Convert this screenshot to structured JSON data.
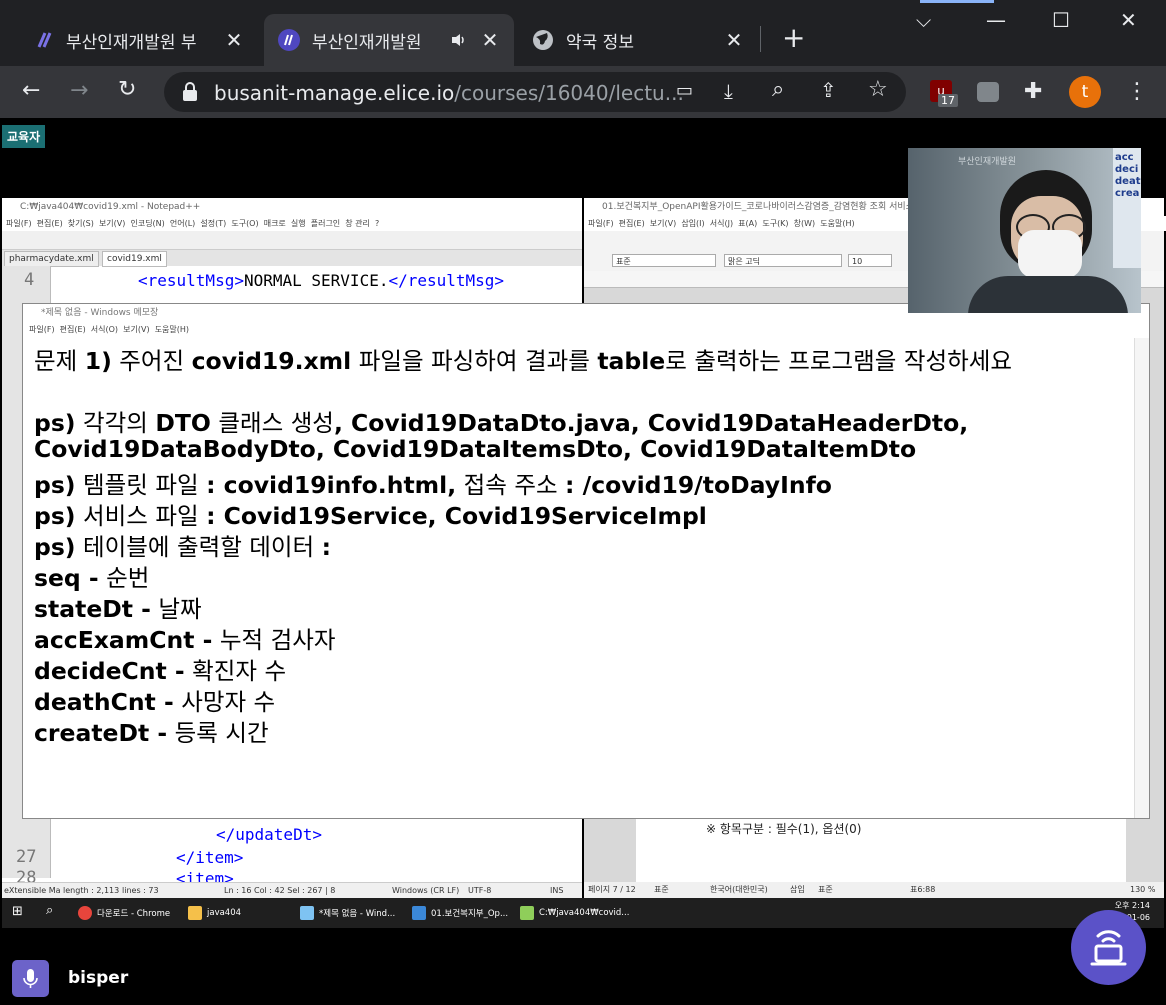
{
  "browser": {
    "tabs": [
      {
        "title": "부산인재개발원 부",
        "favicon": "elice-logo-icon",
        "active": false
      },
      {
        "title": "부산인재개발원",
        "favicon": "elice-logo-icon",
        "active": true,
        "audio": "speaker-icon"
      },
      {
        "title": "약국 정보",
        "favicon": "globe-icon",
        "active": false
      }
    ],
    "url_host": "busanit-manage.elice.io",
    "url_path": "/courses/16040/lectu...",
    "extension_badge": "17",
    "profile_initial": "t",
    "accent": "#4f47c0",
    "profile_color": "#e8710a"
  },
  "share": {
    "role_badge": "교육자",
    "presenter_name": "bisper"
  },
  "notepadpp": {
    "title": "C:₩java404₩covid19.xml - Notepad++",
    "menu": [
      "파일(F)",
      "편집(E)",
      "찾기(S)",
      "보기(V)",
      "인코딩(N)",
      "언어(L)",
      "설정(T)",
      "도구(O)",
      "매크로",
      "실행",
      "플러그인",
      "창 관리",
      "?"
    ],
    "tabs": [
      "pharmacydate.xml",
      "covid19.xml"
    ],
    "lines": [
      {
        "num": "4",
        "open": "<resultMsg>",
        "text": "NORMAL SERVICE.",
        "close": "</resultMsg>"
      },
      {
        "num": "",
        "open": "</updateDt>",
        "text": "",
        "close": ""
      },
      {
        "num": "27",
        "open": "</item>",
        "text": "",
        "close": ""
      },
      {
        "num": "28",
        "open": "<item>",
        "text": "",
        "close": ""
      }
    ],
    "status": {
      "type": "eXtensible Ma length : 2,113",
      "lines": "lines : 73",
      "pos": "Ln : 16    Col : 42    Sel : 267 | 8",
      "eol": "Windows (CR LF)",
      "enc": "UTF-8",
      "mode": "INS"
    }
  },
  "hwp": {
    "title": "01.보건복지부_OpenAPI활용가이드_코로나바이러스감염증_감염현황 조회 서비스_",
    "menu": [
      "파일(F)",
      "편집(E)",
      "보기(V)",
      "삽입(I)",
      "서식(J)",
      "표(A)",
      "도구(K)",
      "창(W)",
      "도움말(H)"
    ],
    "style": "표준",
    "font": "맑은 고딕",
    "size": "10",
    "note": "※ 항목구분 : 필수(1), 옵션(0)",
    "status": {
      "page": "페이지 7 / 12",
      "style": "표준",
      "lang": "한국어(대한민국)",
      "mode": "삽입",
      "cell": "표준",
      "table": "표6:88",
      "zoom": "130 %"
    }
  },
  "notepad": {
    "title": "*제목 없음 - Windows 메모장",
    "menu": [
      "파일(F)",
      "편집(E)",
      "서식(O)",
      "보기(V)",
      "도움말(H)"
    ],
    "lines": [
      "문제 1) 주어진 covid19.xml 파일을 파싱하여 결과를 table로 출력하는 프로그램을 작성하세요",
      "",
      "ps) 각각의 DTO 클래스 생성, Covid19DataDto.java, Covid19DataHeaderDto,",
      "Covid19DataBodyDto, Covid19DataItemsDto, Covid19DataItemDto",
      "ps) 템플릿 파일 : covid19info.html, 접속 주소 : /covid19/toDayInfo",
      "ps) 서비스 파일 : Covid19Service, Covid19ServiceImpl",
      "ps) 테이블에 출력할 데이터 :",
      "seq - 순번",
      "stateDt - 날짜",
      "accExamCnt - 누적 검사자",
      "decideCnt - 확진자 수",
      "deathCnt - 사망자 수",
      "createDt - 등록 시간"
    ]
  },
  "taskbar": {
    "items": [
      {
        "label": "다운로드 - Chrome",
        "icon": "chrome-icon"
      },
      {
        "label": "java404",
        "icon": "folder-icon"
      },
      {
        "label": "*제목 없음 - Wind...",
        "icon": "notepad-icon"
      },
      {
        "label": "01.보건복지부_Op...",
        "icon": "hwp-icon"
      },
      {
        "label": "C:₩java404₩covid...",
        "icon": "notepadpp-icon"
      }
    ],
    "time": "오후 2:14",
    "date": "2022-01-06"
  },
  "webcam": {
    "screen_text": [
      "acc",
      "deci",
      "deat",
      "crea"
    ],
    "sign_text": "부산인재개발원"
  }
}
